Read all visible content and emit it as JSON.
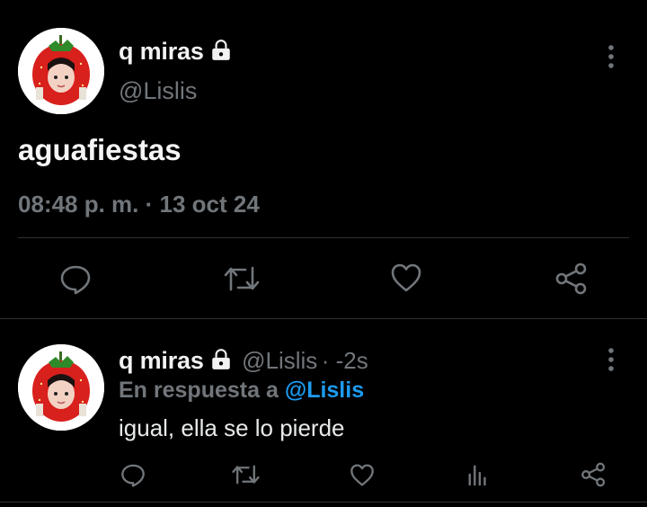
{
  "main_tweet": {
    "display_name": "q miras",
    "handle": "@Lislis",
    "text": "aguafiestas",
    "timestamp": "08:48 p. m. · 13 oct 24",
    "icons": [
      "lock-icon",
      "more-icon",
      "reply-icon",
      "retweet-icon",
      "like-icon",
      "share-icon"
    ]
  },
  "reply_tweet": {
    "display_name": "q miras",
    "handle": "@Lislis",
    "age": "· -2s",
    "replying_prefix": "En respuesta a",
    "replying_mention": "@Lislis",
    "text": "igual, ella se lo pierde",
    "icons": [
      "lock-icon",
      "more-icon",
      "reply-icon",
      "retweet-icon",
      "like-icon",
      "views-icon",
      "share-icon"
    ]
  },
  "colors": {
    "background": "#000000",
    "secondary_text": "#71767b",
    "mention": "#1d9bf0",
    "divider": "#2f3336"
  }
}
